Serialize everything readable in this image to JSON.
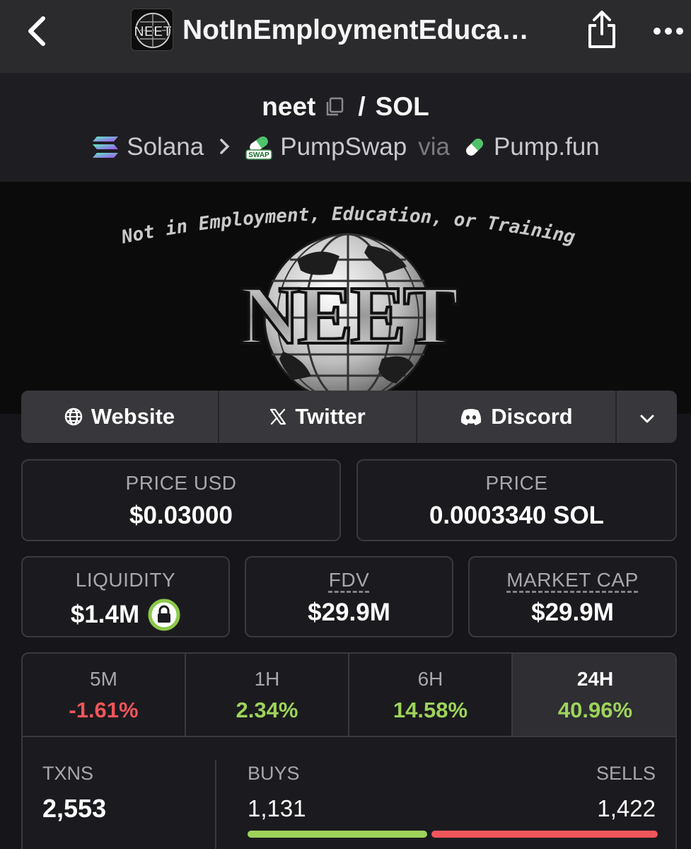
{
  "nav": {
    "title": "NotInEmploymentEduca…",
    "avatar_text": "NEET"
  },
  "pair": {
    "base": "neet",
    "separator": "/",
    "quote": "SOL"
  },
  "route": {
    "chain": "Solana",
    "dex": "PumpSwap",
    "dex_badge": "SWAP",
    "via_label": "via",
    "launchpad": "Pump.fun"
  },
  "banner": {
    "tagline": "Not in Employment, Education, or Training",
    "logo_text": "NEET"
  },
  "links": {
    "website": "Website",
    "twitter": "Twitter",
    "discord": "Discord"
  },
  "stats": {
    "price_usd": {
      "label": "PRICE USD",
      "value": "$0.03000"
    },
    "price": {
      "label": "PRICE",
      "value": "0.0003340 SOL"
    },
    "liquidity": {
      "label": "LIQUIDITY",
      "value": "$1.4M"
    },
    "fdv": {
      "label": "FDV",
      "value": "$29.9M"
    },
    "market_cap": {
      "label": "MARKET CAP",
      "value": "$29.9M"
    }
  },
  "timeframes": [
    {
      "label": "5M",
      "change": "-1.61%"
    },
    {
      "label": "1H",
      "change": "2.34%"
    },
    {
      "label": "6H",
      "change": "14.58%"
    },
    {
      "label": "24H",
      "change": "40.96%"
    }
  ],
  "txns": {
    "label": "TXNS",
    "value": "2,553",
    "buys_label": "BUYS",
    "buys": "1,131",
    "sells_label": "SELLS",
    "sells": "1,422",
    "buy_ratio": 0.443
  },
  "colors": {
    "positive": "#9ed35a",
    "negative": "#f0555a",
    "background": "#16161a"
  }
}
